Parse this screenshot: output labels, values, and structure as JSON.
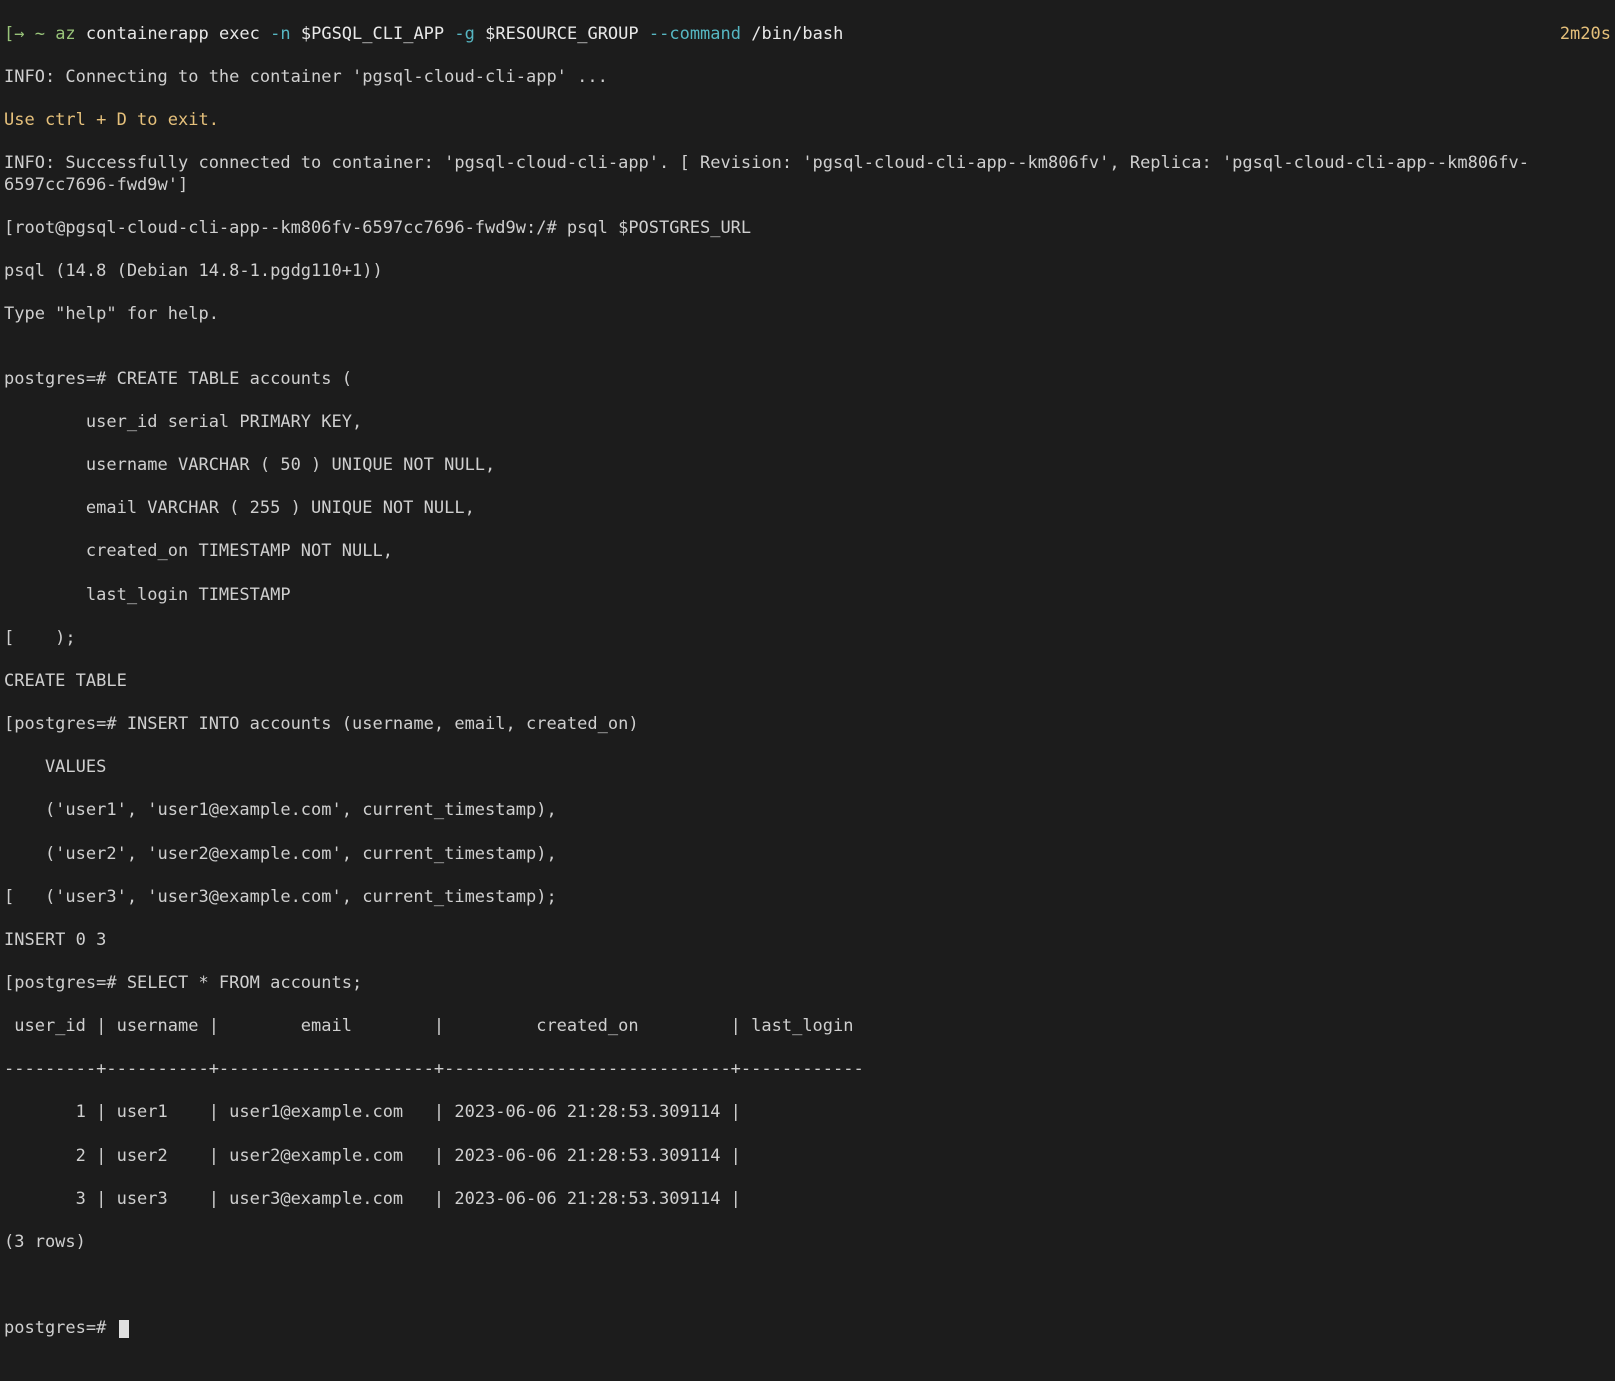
{
  "top": {
    "prompt_marker": "[→ ~ ",
    "cmd": "az",
    "args_plain1": " containerapp exec ",
    "flag_n": "-n",
    "val_n": " $PGSQL_CLI_APP ",
    "flag_g": "-g",
    "val_g": " $RESOURCE_GROUP ",
    "flag_cmd": "--command",
    "val_cmd": " /bin/bash",
    "right_time": "2m20s"
  },
  "info_connecting": "INFO: Connecting to the container 'pgsql-cloud-cli-app' ...",
  "exit_hint": "Use ctrl + D to exit.",
  "info_connected": "INFO: Successfully connected to container: 'pgsql-cloud-cli-app'. [ Revision: 'pgsql-cloud-cli-app--km806fv', Replica: 'pgsql-cloud-cli-app--km806fv-6597cc7696-fwd9w']",
  "shell_prompt_line": "[root@pgsql-cloud-cli-app--km806fv-6597cc7696-fwd9w:/# psql $POSTGRES_URL",
  "psql_ver": "psql (14.8 (Debian 14.8-1.pgdg110+1))",
  "psql_help": "Type \"help\" for help.",
  "blank": "",
  "create_lines": [
    "postgres=# CREATE TABLE accounts (",
    "        user_id serial PRIMARY KEY,",
    "        username VARCHAR ( 50 ) UNIQUE NOT NULL,",
    "        email VARCHAR ( 255 ) UNIQUE NOT NULL,",
    "        created_on TIMESTAMP NOT NULL,",
    "        last_login TIMESTAMP",
    "[    );",
    "CREATE TABLE"
  ],
  "insert_lines": [
    "[postgres=# INSERT INTO accounts (username, email, created_on)",
    "    VALUES",
    "    ('user1', 'user1@example.com', current_timestamp),",
    "    ('user2', 'user2@example.com', current_timestamp),",
    "[   ('user3', 'user3@example.com', current_timestamp);",
    "INSERT 0 3"
  ],
  "select_line": "[postgres=# SELECT * FROM accounts;",
  "table_header": " user_id | username |        email        |         created_on         | last_login ",
  "table_sep": "---------+----------+---------------------+----------------------------+------------",
  "table_rows": [
    "       1 | user1    | user1@example.com   | 2023-06-06 21:28:53.309114 | ",
    "       2 | user2    | user2@example.com   | 2023-06-06 21:28:53.309114 | ",
    "       3 | user3    | user3@example.com   | 2023-06-06 21:28:53.309114 | "
  ],
  "rowcount": "(3 rows)",
  "final_prompt": "postgres=# "
}
